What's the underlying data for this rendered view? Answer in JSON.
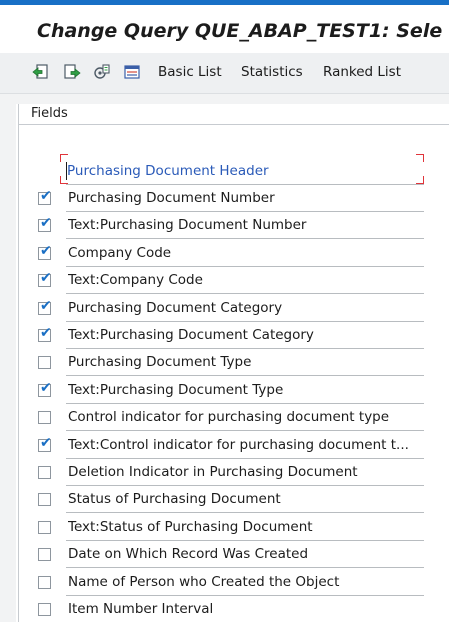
{
  "window": {
    "title": "Change Query QUE_ABAP_TEST1: Sele"
  },
  "toolbar": {
    "icons": [
      "back-arrow-icon",
      "forward-document-icon",
      "refresh-settings-icon",
      "layout-list-icon"
    ],
    "basic_list": "Basic List",
    "statistics": "Statistics",
    "ranked_list": "Ranked List"
  },
  "tabs": {
    "fields": "Fields"
  },
  "group": {
    "header": "Purchasing Document Header"
  },
  "fields": [
    {
      "label": "Purchasing Document Number",
      "checked": true
    },
    {
      "label": "Text:Purchasing Document Number",
      "checked": true
    },
    {
      "label": "Company Code",
      "checked": true
    },
    {
      "label": "Text:Company Code",
      "checked": true
    },
    {
      "label": "Purchasing Document Category",
      "checked": true
    },
    {
      "label": "Text:Purchasing Document Category",
      "checked": true
    },
    {
      "label": "Purchasing Document Type",
      "checked": false
    },
    {
      "label": "Text:Purchasing Document Type",
      "checked": true
    },
    {
      "label": "Control indicator for purchasing document type",
      "checked": false
    },
    {
      "label": "Text:Control indicator for purchasing document t...",
      "checked": true
    },
    {
      "label": "Deletion Indicator in Purchasing Document",
      "checked": false
    },
    {
      "label": "Status of Purchasing Document",
      "checked": false
    },
    {
      "label": "Text:Status of Purchasing Document",
      "checked": false
    },
    {
      "label": "Date on Which Record Was Created",
      "checked": false
    },
    {
      "label": "Name of Person who Created the Object",
      "checked": false
    },
    {
      "label": "Item Number Interval",
      "checked": false
    }
  ],
  "colors": {
    "accent": "#1870c6",
    "check": "#1a6fc4",
    "group_text": "#2a5ab8",
    "focus_corner": "#e0343a"
  }
}
